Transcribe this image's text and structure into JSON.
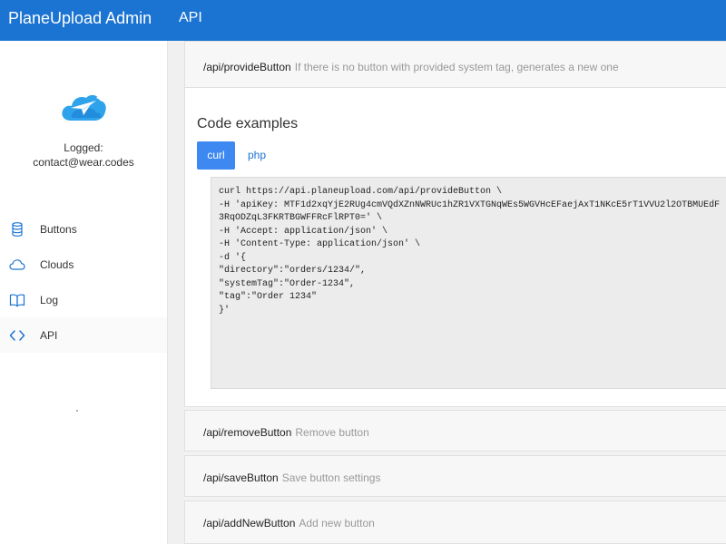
{
  "header": {
    "brand": "PlaneUpload Admin",
    "nav_api": "API"
  },
  "sidebar": {
    "logged_label": "Logged:",
    "logged_email": "contact@wear.codes",
    "items": [
      {
        "label": "Buttons",
        "icon": "stack-icon"
      },
      {
        "label": "Clouds",
        "icon": "cloud-icon"
      },
      {
        "label": "Log",
        "icon": "book-icon"
      },
      {
        "label": "API",
        "icon": "code-icon"
      }
    ]
  },
  "endpoints": [
    {
      "path": "/api/provideButton",
      "description": "If there is no button with provided system tag, generates a new one"
    },
    {
      "path": "/api/removeButton",
      "description": "Remove button"
    },
    {
      "path": "/api/saveButton",
      "description": "Save button settings"
    },
    {
      "path": "/api/addNewButton",
      "description": "Add new button"
    }
  ],
  "code_examples": {
    "title": "Code examples",
    "tabs": [
      "curl",
      "php"
    ],
    "active_tab": "curl",
    "code_lines": [
      "curl https://api.planeupload.com/api/provideButton \\",
      "-H 'apiKey: MTF1d2xqYjE2RUg4cmVQdXZnNWRUc1hZR1VXTGNqWEs5WGVHcEFaejAxT1NKcE5rT1VVU2l2OTBMUEdF",
      "3RqODZqL3FKRTBGWFFRcFlRPT0=' \\",
      "-H 'Accept: application/json' \\",
      "-H 'Content-Type: application/json' \\",
      "-d '{",
      "\"directory\":\"orders/1234/\",",
      "\"systemTag\":\"Order-1234\",",
      "\"tag\":\"Order 1234\"",
      "}'"
    ]
  },
  "colors": {
    "header_bg": "#1b73d2",
    "accent": "#3d89f1",
    "icon": "#1b73d2"
  }
}
